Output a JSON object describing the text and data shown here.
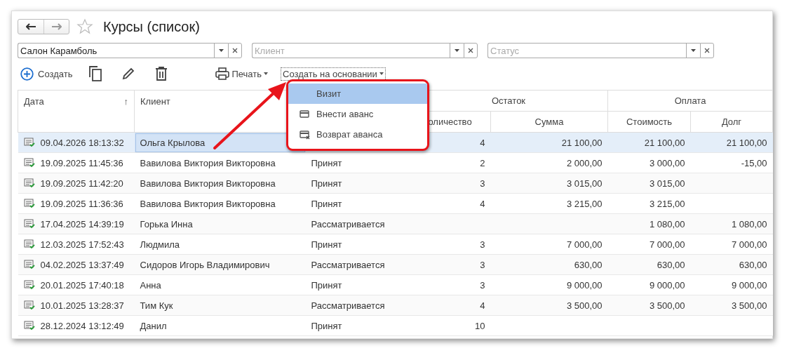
{
  "window": {
    "title": "Курсы (список)",
    "favorite": false
  },
  "filters": [
    {
      "value": "Салон Карамболь"
    },
    {
      "placeholder": "Клиент"
    },
    {
      "placeholder": "Статус"
    }
  ],
  "toolbar": {
    "create": "Создать",
    "print": "Печать",
    "create_based_on": "Создать на основании"
  },
  "table": {
    "header_groups": [
      {
        "label": "Дата",
        "sort_arrow": "↑"
      },
      {
        "label": "Клиент"
      },
      {
        "label": "Остаток",
        "columns": [
          "оличество",
          "Сумма"
        ]
      },
      {
        "label": "Оплата",
        "columns": [
          "Стоимость",
          "Долг"
        ]
      }
    ],
    "rows": [
      {
        "selected": true,
        "date": "09.04.2026 18:13:32",
        "client": "Ольга Крылова",
        "quantity": "4",
        "sum": "21 100,00",
        "cost": "21 100,00",
        "debt": "21 100,00"
      },
      {
        "selected": false,
        "date": "19.09.2025 11:45:36",
        "client": "Вавилова Виктория Викторовна",
        "status": "Принят",
        "quantity": "2",
        "sum": "2 000,00",
        "cost": "3 000,00",
        "debt": "-15,00"
      },
      {
        "selected": false,
        "date": "19.09.2025 11:42:20",
        "client": "Вавилова Виктория Викторовна",
        "status": "Принят",
        "quantity": "3",
        "sum": "3 015,00",
        "cost": "3 015,00"
      },
      {
        "selected": false,
        "date": "19.09.2025 11:36:36",
        "client": "Вавилова Виктория Викторовна",
        "status": "Принят",
        "quantity": "4",
        "sum": "3 215,00",
        "cost": "3 215,00"
      },
      {
        "selected": false,
        "date": "17.04.2025 14:39:19",
        "client": "Горька Инна",
        "status": "Рассматривается",
        "cost": "1 080,00",
        "debt": "1 080,00"
      },
      {
        "selected": false,
        "date": "12.03.2025 17:52:43",
        "client": "Людмила",
        "status": "Принят",
        "quantity": "3",
        "sum": "7 000,00",
        "cost": "7 000,00",
        "debt": "7 000,00"
      },
      {
        "selected": false,
        "date": "04.02.2025 13:37:49",
        "client": "Сидоров Игорь Владимирович",
        "status": "Рассматривается",
        "quantity": "3",
        "sum": "630,00",
        "cost": "630,00",
        "debt": "630,00"
      },
      {
        "selected": false,
        "date": "20.01.2025 17:40:18",
        "client": "Анна",
        "status": "Принят",
        "quantity": "3",
        "sum": "9 000,00",
        "cost": "9 000,00",
        "debt": "9 000,00"
      },
      {
        "selected": false,
        "date": "10.01.2025 13:28:37",
        "client": "Тим Кук",
        "status": "Рассматривается",
        "quantity": "4",
        "sum": "3 500,00",
        "cost": "3 500,00",
        "debt": "3 500,00"
      },
      {
        "selected": false,
        "date": "28.12.2024 13:12:49",
        "client": "Данил",
        "status": "Принят",
        "quantity": "10"
      }
    ]
  },
  "popup_menu": {
    "items": [
      {
        "label": "Визит",
        "kind": "plain",
        "selected": true
      },
      {
        "label": "Внести аванс",
        "kind": "card",
        "selected": false
      },
      {
        "label": "Возврат аванса",
        "kind": "card-remove",
        "selected": false
      }
    ]
  }
}
